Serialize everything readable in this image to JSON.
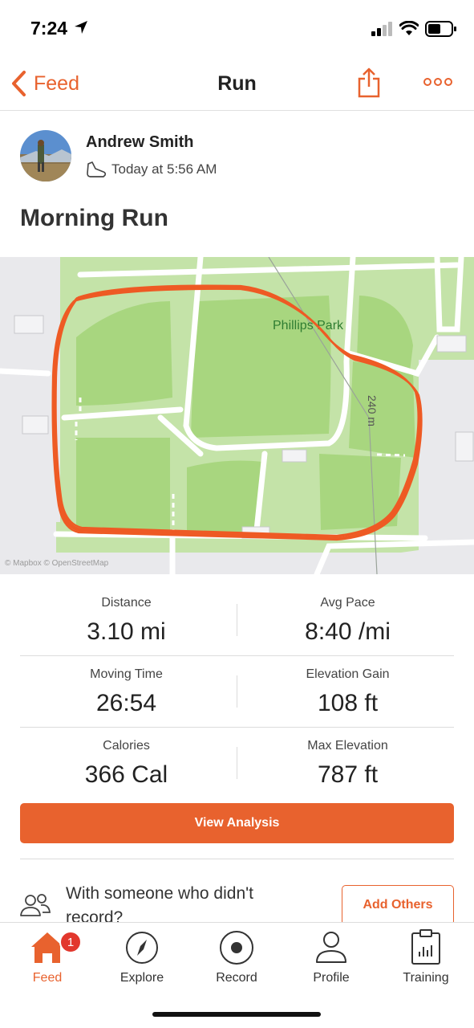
{
  "status_bar": {
    "time": "7:24"
  },
  "nav": {
    "back_label": "Feed",
    "title": "Run"
  },
  "athlete": {
    "name": "Andrew Smith",
    "time": "Today at 5:56 AM"
  },
  "activity": {
    "title": "Morning Run"
  },
  "map": {
    "park_label": "Phillips Park",
    "scale_label": "240 m",
    "attribution": "© Mapbox © OpenStreetMap",
    "route_color": "#ee5a24"
  },
  "stats": [
    {
      "left_label": "Distance",
      "left_value": "3.10 mi",
      "right_label": "Avg Pace",
      "right_value": "8:40 /mi"
    },
    {
      "left_label": "Moving Time",
      "left_value": "26:54",
      "right_label": "Elevation Gain",
      "right_value": "108 ft"
    },
    {
      "left_label": "Calories",
      "left_value": "366 Cal",
      "right_label": "Max Elevation",
      "right_value": "787 ft"
    }
  ],
  "actions": {
    "view_analysis": "View Analysis",
    "with_someone": "With someone who didn't record?",
    "add_others": "Add Others"
  },
  "tabs": [
    {
      "label": "Feed",
      "icon": "home-icon",
      "active": true,
      "badge": "1"
    },
    {
      "label": "Explore",
      "icon": "compass-icon"
    },
    {
      "label": "Record",
      "icon": "record-icon"
    },
    {
      "label": "Profile",
      "icon": "profile-icon"
    },
    {
      "label": "Training",
      "icon": "training-icon"
    }
  ],
  "colors": {
    "accent": "#e8622e",
    "badge": "#e2372d"
  }
}
